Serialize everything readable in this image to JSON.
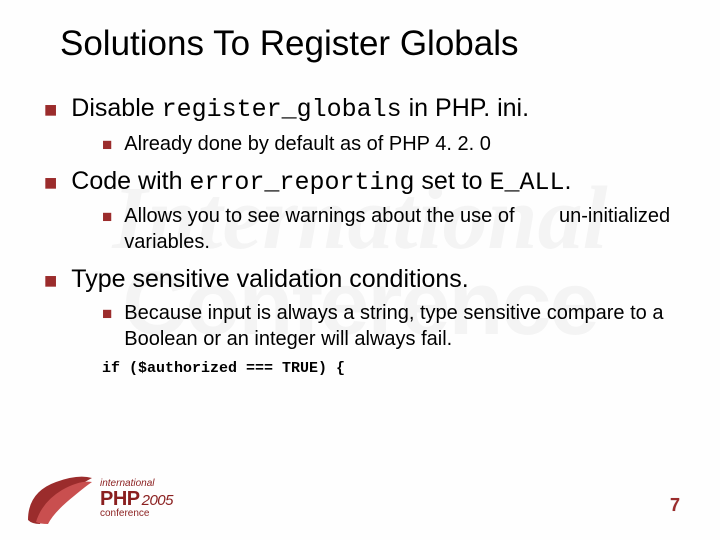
{
  "slide": {
    "title": "Solutions To Register Globals",
    "items": [
      {
        "pre": "Disable ",
        "code": "register_globals",
        "post": " in PHP. ini.",
        "sub": [
          {
            "text": "Already done by default as of PHP 4. 2. 0"
          }
        ]
      },
      {
        "pre": "Code with ",
        "code": "error_reporting",
        "post": " set to ",
        "code2": "E_ALL",
        "post2": ".",
        "sub": [
          {
            "text": "Allows you to see warnings about the use of        un-initialized variables."
          }
        ]
      },
      {
        "pre": "Type sensitive validation conditions.",
        "sub": [
          {
            "text": "Because input is always a string, type sensitive compare to a Boolean or an integer will always fail."
          }
        ],
        "codeblock": "if ($authorized === TRUE) {"
      }
    ]
  },
  "footer": {
    "logo_intl": "international",
    "logo_main": "PHP",
    "logo_year": "2005",
    "logo_conf": "conference",
    "page_number": "7"
  }
}
